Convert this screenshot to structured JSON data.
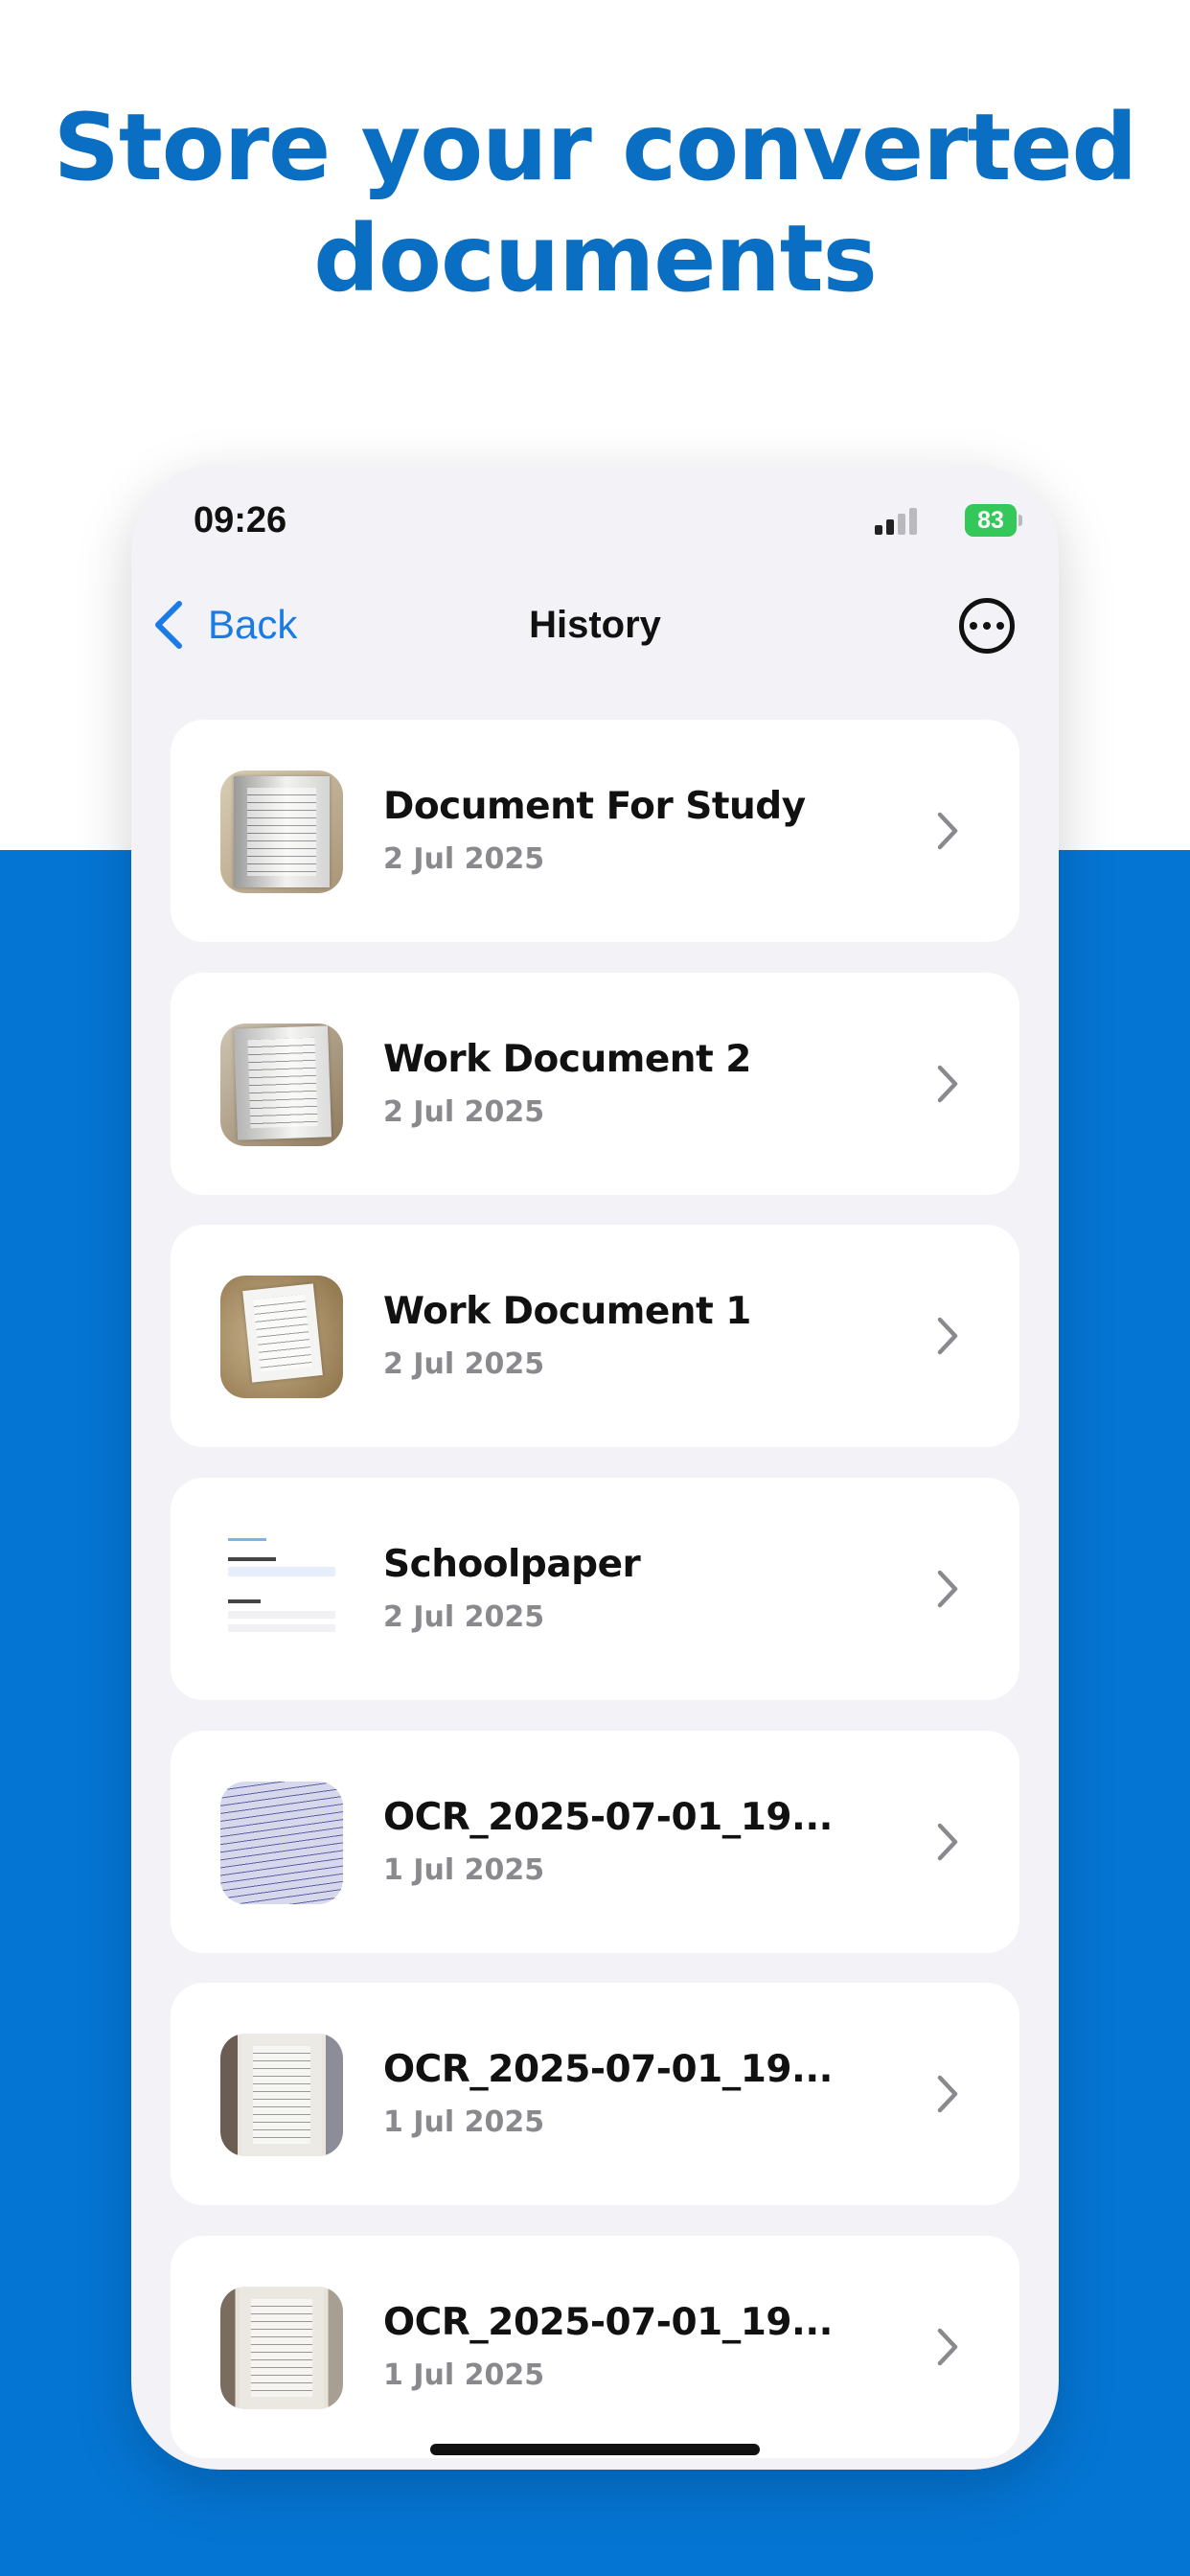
{
  "headline": {
    "line1": "Store your converted",
    "line2": "documents"
  },
  "status_bar": {
    "time": "09:26",
    "battery": "83"
  },
  "nav": {
    "back_label": "Back",
    "title": "History",
    "more_icon": "ellipsis-circle-icon"
  },
  "documents": [
    {
      "title": "Document For Study",
      "date": "2 Jul 2025"
    },
    {
      "title": "Work Document 2",
      "date": "2 Jul 2025"
    },
    {
      "title": "Work Document 1",
      "date": "2 Jul 2025"
    },
    {
      "title": "Schoolpaper",
      "date": "2 Jul 2025"
    },
    {
      "title": "OCR_2025-07-01_19...",
      "date": "1 Jul 2025"
    },
    {
      "title": "OCR_2025-07-01_19...",
      "date": "1 Jul 2025"
    },
    {
      "title": "OCR_2025-07-01_19...",
      "date": "1 Jul 2025"
    }
  ],
  "colors": {
    "brand_blue": "#0575D3",
    "headline_blue": "#0A6EC2",
    "ios_link": "#1A7BE5",
    "battery_green": "#34C759"
  }
}
